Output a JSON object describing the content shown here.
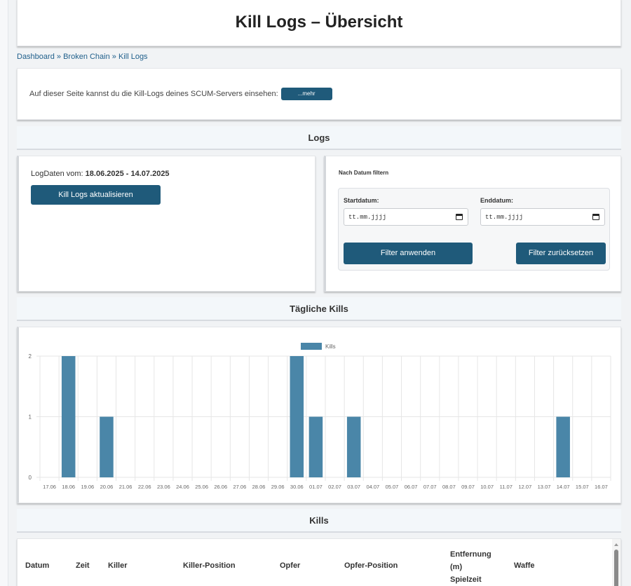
{
  "page": {
    "title": "Kill Logs – Übersicht"
  },
  "breadcrumb": {
    "items": [
      "Dashboard",
      "Broken Chain",
      "Kill Logs"
    ],
    "separator": "»"
  },
  "info": {
    "text": "Auf dieser Seite kannst du die Kill-Logs deines SCUM-Servers einsehen:",
    "more_label": "...mehr"
  },
  "sections": {
    "logs": "Logs",
    "daily_kills": "Tägliche Kills",
    "kills": "Kills"
  },
  "logs": {
    "date_label": "LogDaten vom:",
    "date_range": "18.06.2025 - 14.07.2025",
    "refresh_label": "Kill Logs aktualisieren"
  },
  "filter": {
    "title": "Nach Datum filtern",
    "start_label": "Startdatum:",
    "end_label": "Enddatum:",
    "start_placeholder": "tt.mm.jjjj",
    "end_placeholder": "tt.mm.jjjj",
    "apply_label": "Filter anwenden",
    "reset_label": "Filter zurücksetzen"
  },
  "chart_data": {
    "type": "bar",
    "categories": [
      "17.06",
      "18.06",
      "19.06",
      "20.06",
      "21.06",
      "22.06",
      "23.06",
      "24.06",
      "25.06",
      "26.06",
      "27.06",
      "28.06",
      "29.06",
      "30.06",
      "01.07",
      "02.07",
      "03.07",
      "04.07",
      "05.07",
      "06.07",
      "07.07",
      "08.07",
      "09.07",
      "10.07",
      "11.07",
      "12.07",
      "13.07",
      "14.07",
      "15.07",
      "16.07"
    ],
    "series": [
      {
        "name": "Kills",
        "values": [
          0,
          2,
          0,
          1,
          0,
          0,
          0,
          0,
          0,
          0,
          0,
          0,
          0,
          2,
          1,
          0,
          1,
          0,
          0,
          0,
          0,
          0,
          0,
          0,
          0,
          0,
          0,
          1,
          0,
          0
        ]
      }
    ],
    "ylim": [
      0,
      2
    ],
    "yticks": [
      0,
      1,
      2
    ],
    "grid": true,
    "legend": "top-center",
    "colors": {
      "bar": "#4a86a8",
      "grid": "#e6e6e6"
    }
  },
  "table": {
    "columns": [
      "Datum",
      "Zeit",
      "Killer",
      "Killer-Position",
      "Opfer",
      "Opfer-Position",
      "Entfernung (m) Spielzeit",
      "Waffe"
    ],
    "distance_lines": [
      "Entfernung",
      "(m)",
      "Spielzeit"
    ]
  },
  "colors": {
    "accent": "#1f5a7a",
    "link": "#1f5f8b"
  }
}
